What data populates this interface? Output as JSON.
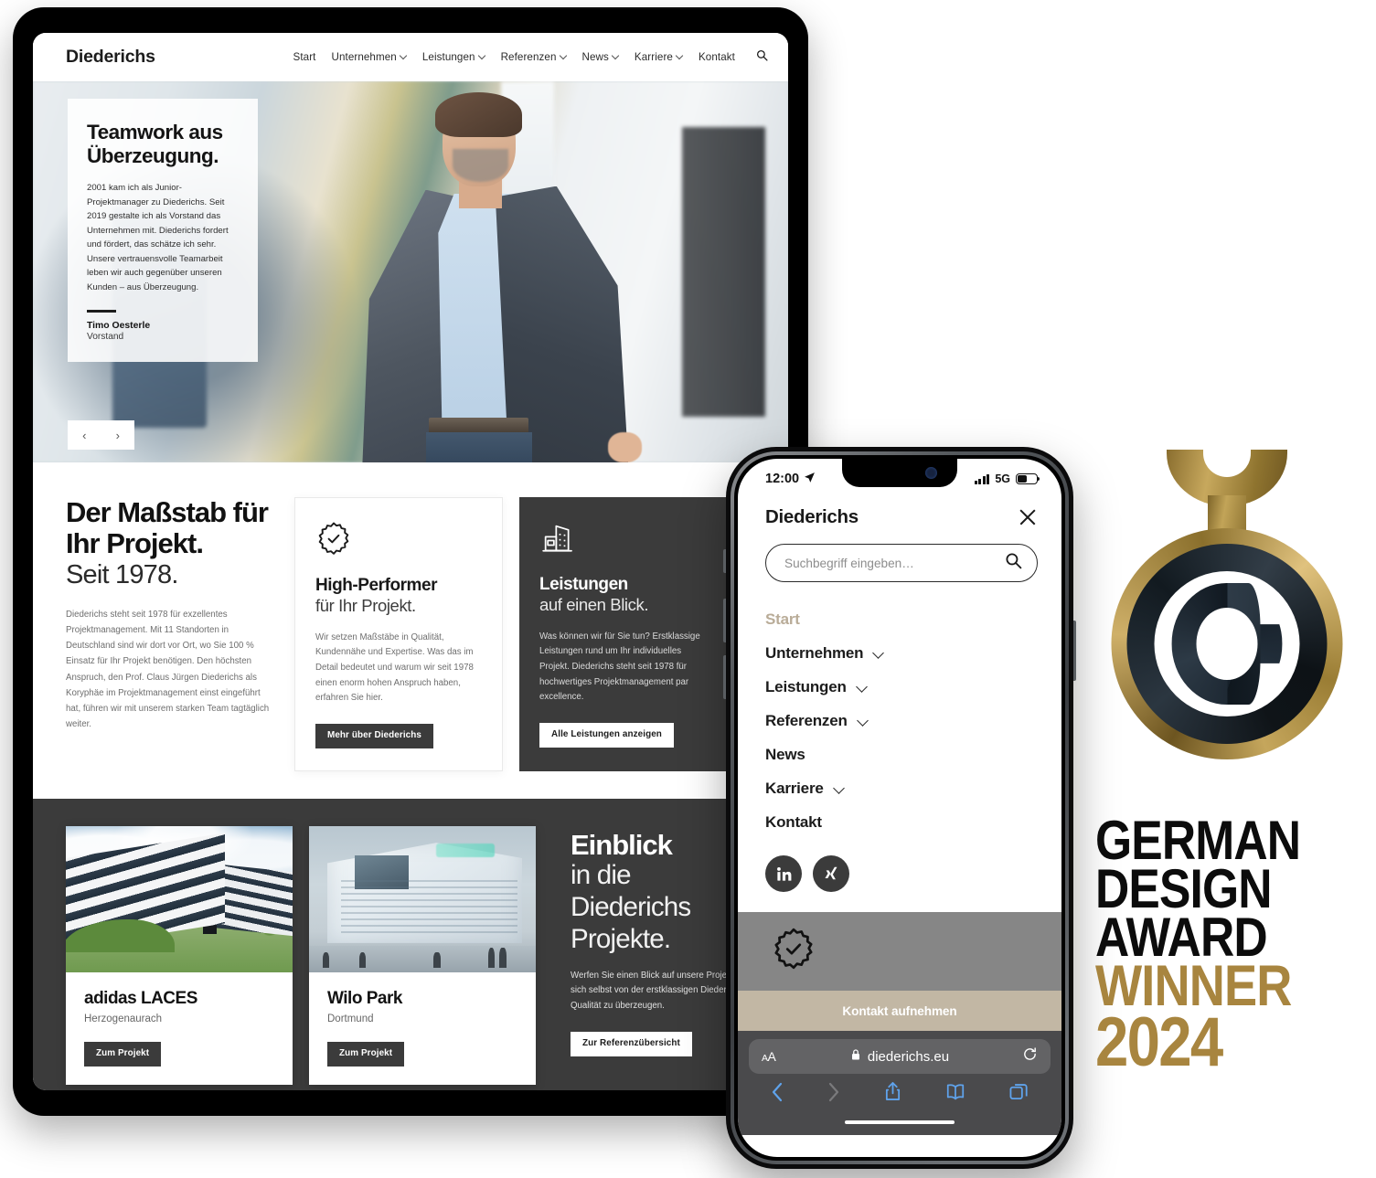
{
  "tablet": {
    "nav": {
      "brand": "Diederichs",
      "links": [
        {
          "label": "Start",
          "caret": false
        },
        {
          "label": "Unternehmen",
          "caret": true
        },
        {
          "label": "Leistungen",
          "caret": true
        },
        {
          "label": "Referenzen",
          "caret": true
        },
        {
          "label": "News",
          "caret": true
        },
        {
          "label": "Karriere",
          "caret": true
        },
        {
          "label": "Kontakt",
          "caret": false
        }
      ],
      "search_icon": "search-icon"
    },
    "hero": {
      "title_line1": "Teamwork aus",
      "title_line2": "Überzeugung.",
      "quote": "2001 kam ich als Junior-Projektmanager zu Diederichs. Seit 2019 gestalte ich als Vorstand das Unternehmen mit. Diederichs fordert und fördert, das schätze ich sehr. Unsere vertrauensvolle Teamarbeit leben wir auch gegenüber unseren Kunden – aus Überzeugung.",
      "name": "Timo Oesterle",
      "role": "Vorstand",
      "prev_arrow": "‹",
      "next_arrow": "›"
    },
    "intro": {
      "heading": "Der Maßstab für Ihr Projekt.",
      "subheading": "Seit 1978.",
      "body": "Diederichs steht seit 1978 für exzellentes Projektmanagement. Mit 11 Standorten in Deutschland sind wir dort vor Ort, wo Sie 100 % Einsatz für Ihr Projekt benötigen. Den höchsten Anspruch, den Prof. Claus Jürgen Diederichs als Koryphäe im Projektmanagement einst eingeführt hat, führen wir mit unserem starken Team tagtäglich weiter."
    },
    "cards": [
      {
        "icon": "badge-check-icon",
        "title": "High-Performer",
        "subtitle": "für Ihr Projekt.",
        "body": "Wir setzen Maßstäbe in Qualität, Kundennähe und Expertise. Was das im Detail bedeutet und warum wir seit 1978 einen enorm hohen Anspruch haben, erfahren Sie hier.",
        "button": "Mehr über Diederichs"
      },
      {
        "icon": "building-icon",
        "title": "Leistungen",
        "subtitle": "auf einen Blick.",
        "body": "Was können wir für Sie tun? Erstklassige Leistungen rund um Ihr individuelles Projekt. Diederichs steht seit 1978 für hochwertiges Projektmanagement par excellence.",
        "button": "Alle Leistungen anzeigen"
      }
    ],
    "projects": [
      {
        "title": "adidas LACES",
        "location": "Herzogenaurach",
        "button": "Zum Projekt"
      },
      {
        "title": "Wilo Park",
        "location": "Dortmund",
        "button": "Zum Projekt"
      }
    ],
    "einblick": {
      "heading": "Einblick",
      "subheading_line1": "in die",
      "subheading_line2": "Diederichs",
      "subheading_line3": "Projekte.",
      "body": "Werfen Sie einen Blick auf unsere Projekte, sich selbst von der erstklassigen Diederichs Qualität zu überzeugen.",
      "button": "Zur Referenzübersicht"
    }
  },
  "phone": {
    "status": {
      "time": "12:00",
      "location_icon": "location-arrow-icon",
      "network": "5G",
      "signal_icon": "signal-bars-icon",
      "battery_icon": "battery-icon"
    },
    "header": {
      "brand": "Diederichs",
      "close_icon": "close-icon"
    },
    "search": {
      "placeholder": "Suchbegriff eingeben…",
      "value": "",
      "icon": "search-icon"
    },
    "menu": [
      {
        "label": "Start",
        "caret": false,
        "active": true
      },
      {
        "label": "Unternehmen",
        "caret": true,
        "active": false
      },
      {
        "label": "Leistungen",
        "caret": true,
        "active": false
      },
      {
        "label": "Referenzen",
        "caret": true,
        "active": false
      },
      {
        "label": "News",
        "caret": false,
        "active": false
      },
      {
        "label": "Karriere",
        "caret": true,
        "active": false
      },
      {
        "label": "Kontakt",
        "caret": false,
        "active": false
      }
    ],
    "socials": [
      {
        "name": "linkedin-icon",
        "glyph": "in"
      },
      {
        "name": "xing-icon",
        "glyph": "X"
      }
    ],
    "peek": {
      "icon": "badge-check-icon"
    },
    "cta": "Kontakt aufnehmen",
    "safari": {
      "aa_label": "AA",
      "lock_icon": "lock-icon",
      "url": "diederichs.eu",
      "reload_icon": "reload-icon",
      "back_icon": "chevron-left-icon",
      "forward_icon": "chevron-right-icon",
      "share_icon": "share-icon",
      "bookmarks_icon": "book-icon",
      "tabs_icon": "tabs-icon"
    }
  },
  "award": {
    "medal_icon": "german-design-award-medal",
    "line1": "GERMAN",
    "line2": "DESIGN",
    "line3": "AWARD",
    "line4": "WINNER",
    "year": "2024",
    "gold": "#a8853f",
    "black": "#0c0c0c"
  }
}
